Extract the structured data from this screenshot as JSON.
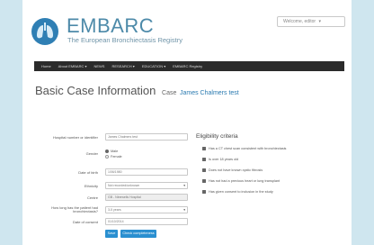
{
  "header": {
    "brand": "EMBARC",
    "subtitle": "The European Bronchiectasis Registry",
    "welcome": "Welcome, editor"
  },
  "nav": [
    "Home",
    "About EMBARC ▾",
    "NEWS",
    "RESEARCH ▾",
    "EDUCATION ▾",
    "EMBARC Registry"
  ],
  "page": {
    "title": "Basic Case Information",
    "case_prefix": "Case",
    "case_name": "James Chalmers test"
  },
  "form": {
    "hospital_label": "Hospital number or identifier",
    "hospital_value": "James Chalmers test",
    "gender_label": "Gender",
    "gender_options": [
      "Male",
      "Female"
    ],
    "gender_selected": "Male",
    "dob_label": "Date of birth",
    "dob_value": "1/06/1980",
    "ethnicity_label": "Ethnicity",
    "ethnicity_value": "Not recorded/unknown",
    "centre_label": "Centre",
    "centre_value": "GB - Ninewells Hospital",
    "duration_label": "How long has the patient had bronchiectasis?",
    "duration_value": "3-5 years",
    "consent_label": "Date of consent",
    "consent_value": "01/10/2014",
    "save_label": "Save",
    "complete_label": "Check completeness"
  },
  "eligibility": {
    "title": "Eligibility criteria",
    "criteria": [
      "Has a CT chest scan consistent with bronchiectasis",
      "Is over 18 years old",
      "Does not have known cystic fibrosis",
      "Has not had a previous heart or lung transplant",
      "Has given consent to inclusion in the study"
    ]
  },
  "colors": {
    "background": "#cfe6ef",
    "brand": "#4d8aa9",
    "navbar": "#2b2b2b",
    "link": "#2a7ab0",
    "button": "#2a8fd0"
  }
}
